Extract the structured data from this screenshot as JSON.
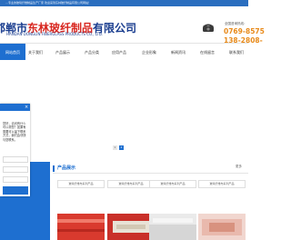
{
  "top_strip": {
    "text": "…专业的玻璃纤维制品生产厂家 欢迎来到东林玻纤制品有限公司网站！"
  },
  "header": {
    "logo_cn_prefix": "邯郸市",
    "logo_cn_brand": "东林玻纤制品",
    "logo_cn_suffix": "有限公司",
    "logo_en": "HANDAN DONGLIN FIBERGLASS PRODUCTS CO., LTD.",
    "hotline_label": "全国咨询热线：",
    "hotline_1": "0769-8575",
    "hotline_2": "138-2808-"
  },
  "nav": {
    "items": [
      {
        "label": "网站首页",
        "active": true
      },
      {
        "label": "关于我们",
        "active": false
      },
      {
        "label": "产品展示",
        "active": false
      },
      {
        "label": "产品分类",
        "active": false
      },
      {
        "label": "应用产品",
        "active": false
      },
      {
        "label": "企业形象",
        "active": false
      },
      {
        "label": "新闻资讯",
        "active": false
      },
      {
        "label": "在线留言",
        "active": false
      },
      {
        "label": "联系我们",
        "active": false
      }
    ]
  },
  "banner": {
    "pagination": [
      "1",
      "2"
    ]
  },
  "chat": {
    "close": "×",
    "message": "您好，请问有什么可以帮您？如果有需要可以留下联系方式，我们会尽快与您联系。"
  },
  "products": {
    "section_title": "产品展示",
    "more": "更多",
    "tabs": [
      "玻璃纤维布系列产品",
      "玻璃纤维布系列产品",
      "玻璃纤维布系列产品",
      "玻璃纤维布系列产品"
    ]
  },
  "colors": {
    "primary": "#1e6fd0",
    "top_strip": "#2a6ebf",
    "logo_blue": "#1a3d8f",
    "logo_red": "#d8261f",
    "hotline": "#e88a1a"
  }
}
